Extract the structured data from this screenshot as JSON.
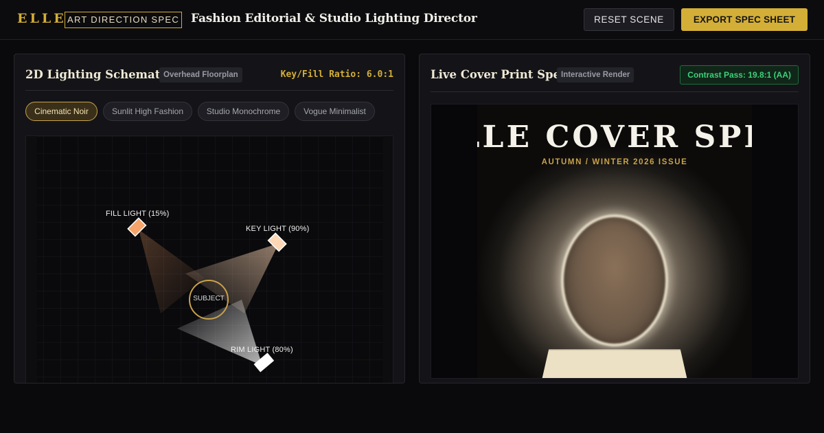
{
  "header": {
    "logo": "ELLE",
    "spec_badge": "ART DIRECTION SPEC",
    "title": "Fashion Editorial & Studio Lighting Director",
    "reset_label": "RESET SCENE",
    "export_label": "EXPORT SPEC SHEET"
  },
  "schematic_panel": {
    "title": "2D Lighting Schematic",
    "tag": "Overhead Floorplan",
    "ratio": "Key/Fill Ratio: 6.0:1",
    "presets": [
      {
        "label": "Cinematic Noir",
        "active": true
      },
      {
        "label": "Sunlit High Fashion",
        "active": false
      },
      {
        "label": "Studio Monochrome",
        "active": false
      },
      {
        "label": "Vogue Minimalist",
        "active": false
      }
    ],
    "lights": {
      "fill": {
        "label": "FILL LIGHT (15%)",
        "intensity": 0.15,
        "color": "#f6a36a"
      },
      "key": {
        "label": "KEY LIGHT (90%)",
        "intensity": 0.9,
        "color": "#ffd7b5"
      },
      "rim": {
        "label": "RIM LIGHT (80%)",
        "intensity": 0.8,
        "color": "#ffffff"
      }
    },
    "subject_label": "SUBJECT"
  },
  "cover_panel": {
    "title": "Live Cover Print Spec",
    "tag": "Interactive Render",
    "contrast": "Contrast Pass: 19.8:1 (AA)",
    "cover_title": "ELLE COVER SPEC",
    "issue": "AUTUMN / WINTER 2026 ISSUE"
  },
  "colors": {
    "accent": "#d4af37",
    "pass": "#3ed07a",
    "background": "#0a0a0c"
  }
}
